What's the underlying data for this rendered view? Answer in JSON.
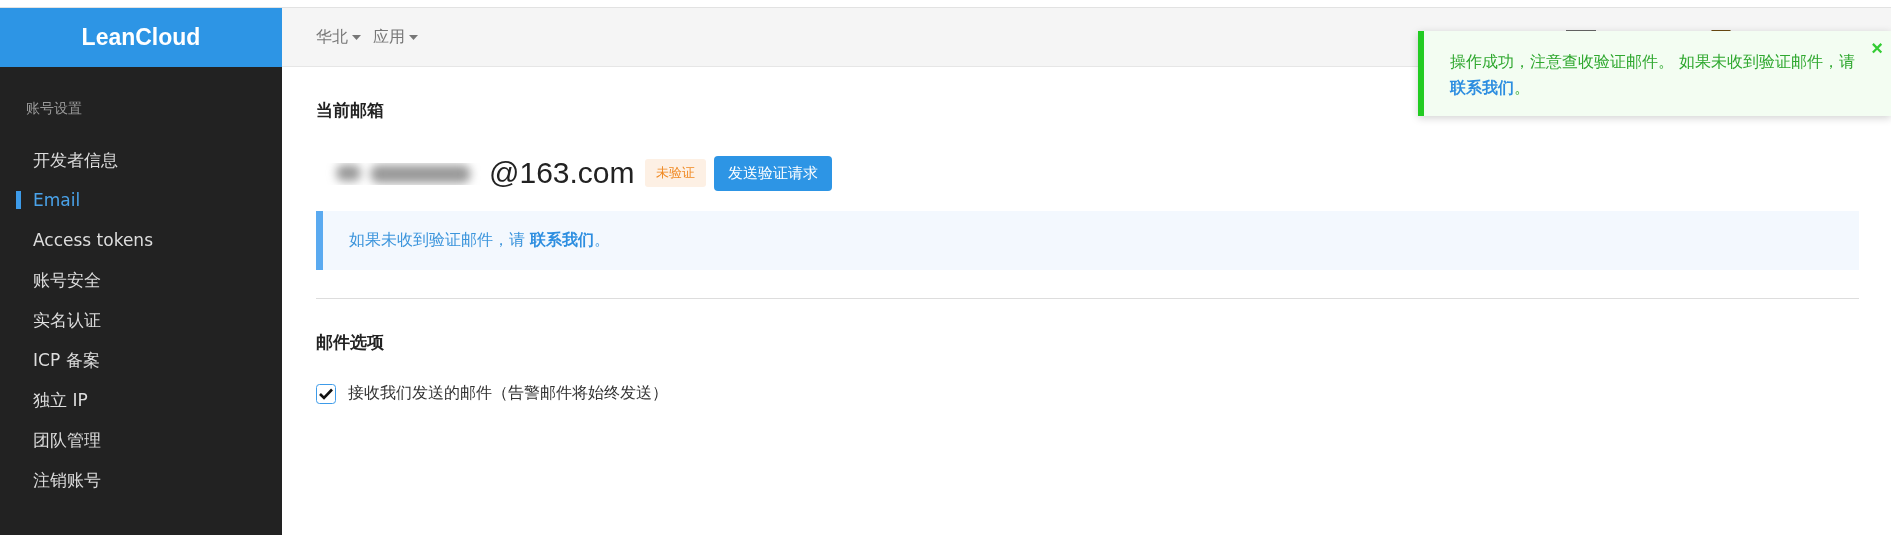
{
  "logo": "LeanCloud",
  "header": {
    "menus": [
      {
        "label": "华北"
      },
      {
        "label": "应用"
      }
    ]
  },
  "sidebar": {
    "section": "账号设置",
    "items": [
      {
        "label": "开发者信息",
        "selected": false
      },
      {
        "label": "Email",
        "selected": true
      },
      {
        "label": "Access tokens",
        "selected": false
      },
      {
        "label": "账号安全",
        "selected": false
      },
      {
        "label": "实名认证",
        "selected": false
      },
      {
        "label": "ICP 备案",
        "selected": false
      },
      {
        "label": "独立 IP",
        "selected": false
      },
      {
        "label": "团队管理",
        "selected": false
      },
      {
        "label": "注销账号",
        "selected": false
      }
    ]
  },
  "current_email": {
    "title": "当前邮箱",
    "address_suffix": "@163.com",
    "badge": "未验证",
    "verified": false,
    "button": "发送验证请求"
  },
  "info": {
    "text": "如果未收到验证邮件，请 ",
    "link": "联系我们",
    "end": "。"
  },
  "options": {
    "title": "邮件选项",
    "checkbox": {
      "label": "接收我们发送的邮件（告警邮件将始终发送）",
      "checked": true
    }
  },
  "toast": {
    "kind": "success",
    "text": "操作成功，注意查收验证邮件。 如果未收到验证邮件，请 ",
    "link": "联系我们",
    "end": "。",
    "close": "×"
  }
}
